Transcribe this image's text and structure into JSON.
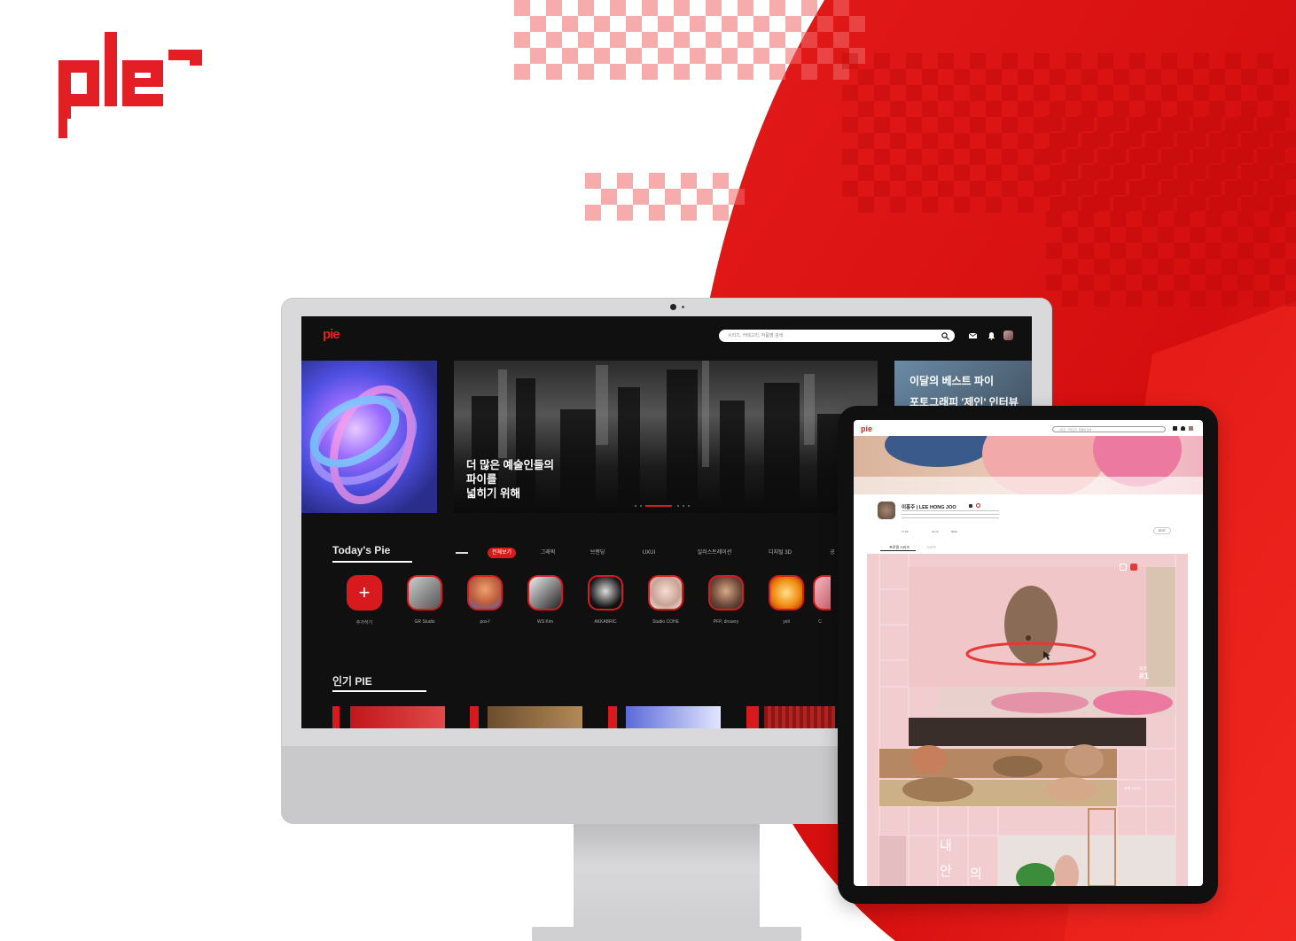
{
  "brand": {
    "logo_text": "pie",
    "accent_color": "#e31e24"
  },
  "monitor": {
    "header": {
      "logo": "pie",
      "search_placeholder": "시리즈, 카테고리, 작품명 검색",
      "icons": [
        "mail-icon",
        "bell-icon",
        "profile-icon"
      ]
    },
    "hero": {
      "main_text": "더 많은 예술인들의\n파이를\n넓히기 위해",
      "side_title": "이달의 베스트 파이",
      "side_subtitle": "포토그래피 '제인' 인터뷰"
    },
    "todays_pie": {
      "title": "Today's Pie",
      "tabs": [
        "전체보기",
        "그래픽",
        "브랜딩",
        "UXUI",
        "일러스트레이션",
        "디지털 3D",
        "공"
      ],
      "creators": [
        "추가하기",
        "GR Studio",
        "pos-f",
        "WS Kim",
        "AKKABRIC",
        "Studio COHE",
        "PFP, drosery",
        "yell",
        "C"
      ]
    },
    "popular": {
      "title": "인기 PIE"
    }
  },
  "tablet": {
    "header": {
      "logo": "pie",
      "search_placeholder": "시리즈, 카테고리, 작품명 검색"
    },
    "profile": {
      "name": "이홍주 | LEE HONG JOO",
      "edit_label": "EDIT",
      "tab_active": "프로필 시리즈",
      "tab_inactive": "시리즈",
      "stats": [
        "17.8K",
        "32.1K",
        "8000"
      ]
    },
    "gallery": {
      "badge_1_label": "포장",
      "badge_1_number": "#1",
      "side_label": "조형 시리즈",
      "vertical_chars": [
        "내",
        "안",
        "의"
      ],
      "pink_color": "#f2cdd0"
    }
  }
}
